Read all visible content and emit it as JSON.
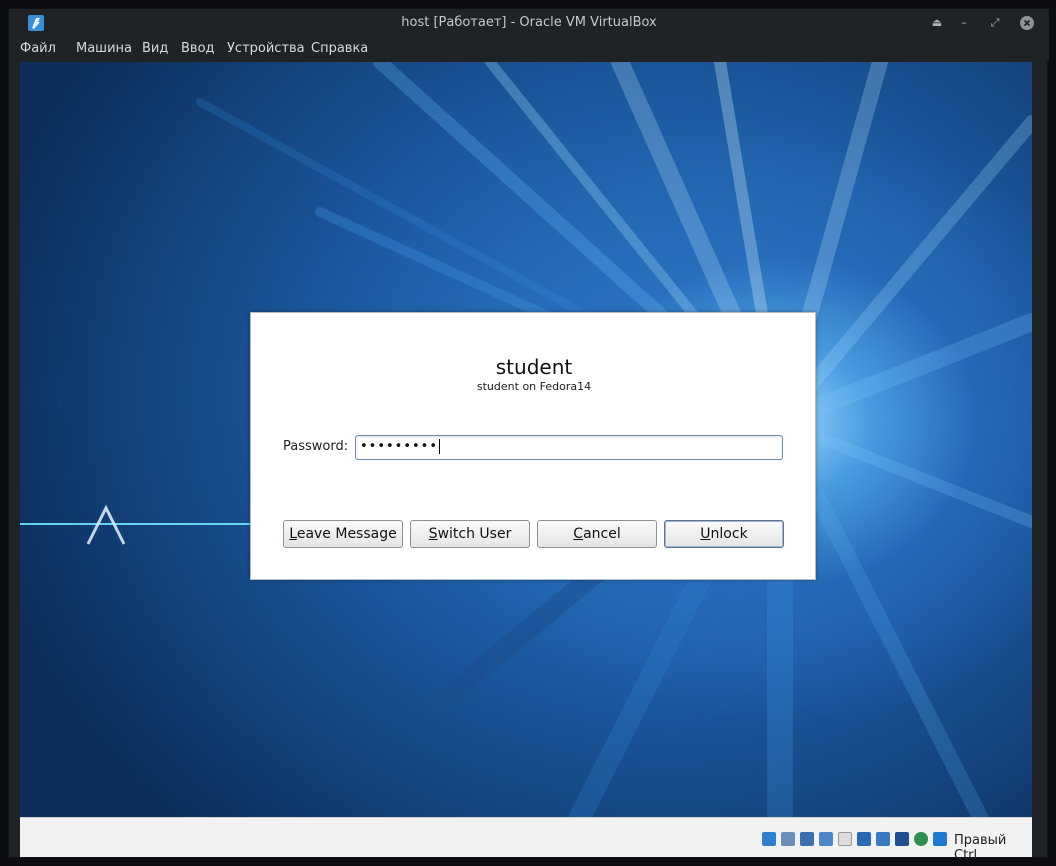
{
  "window": {
    "title": "host [Работает] - Oracle VM VirtualBox"
  },
  "menu": {
    "items": [
      "Файл",
      "Машина",
      "Вид",
      "Ввод",
      "Устройства",
      "Справка"
    ]
  },
  "dialog": {
    "username": "student",
    "host_line": "student on Fedora14",
    "password_label": "Password:",
    "password_value": "•••••••••",
    "buttons": {
      "leave_message": {
        "pre": "",
        "mnemonic": "L",
        "rest": "eave Message"
      },
      "switch_user": {
        "pre": "",
        "mnemonic": "S",
        "rest": "witch User"
      },
      "cancel": {
        "pre": "",
        "mnemonic": "C",
        "rest": "ancel"
      },
      "unlock": {
        "pre": "",
        "mnemonic": "U",
        "rest": "nlock"
      }
    }
  },
  "statusbar": {
    "host_key": "Правый Ctrl",
    "icons": [
      "hard-disk-icon",
      "optical-drive-icon",
      "audio-icon",
      "network-icon",
      "usb-icon",
      "shared-folders-icon",
      "display-icon",
      "video-capture-icon",
      "virtualization-icon",
      "mouse-integration-icon",
      "keyboard-capture-icon"
    ]
  },
  "colors": {
    "frame": "#1f2326",
    "wallpaper_dark": "#0d2e5a",
    "wallpaper_light": "#9ad8ff",
    "dialog_bg": "#ffffff"
  }
}
